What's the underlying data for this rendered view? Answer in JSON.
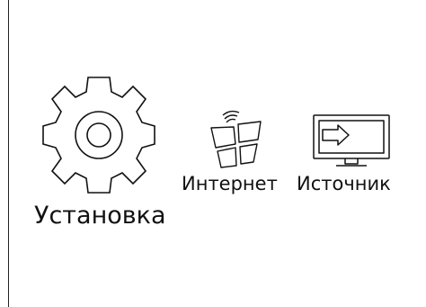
{
  "menu": {
    "items": [
      {
        "label": "Установка",
        "icon": "gear-icon",
        "selected": true
      },
      {
        "label": "Интернет",
        "icon": "internet-icon",
        "selected": false
      },
      {
        "label": "Источник",
        "icon": "source-input-icon",
        "selected": false
      }
    ]
  },
  "colors": {
    "background": "#ffffff",
    "foreground": "#111111"
  }
}
